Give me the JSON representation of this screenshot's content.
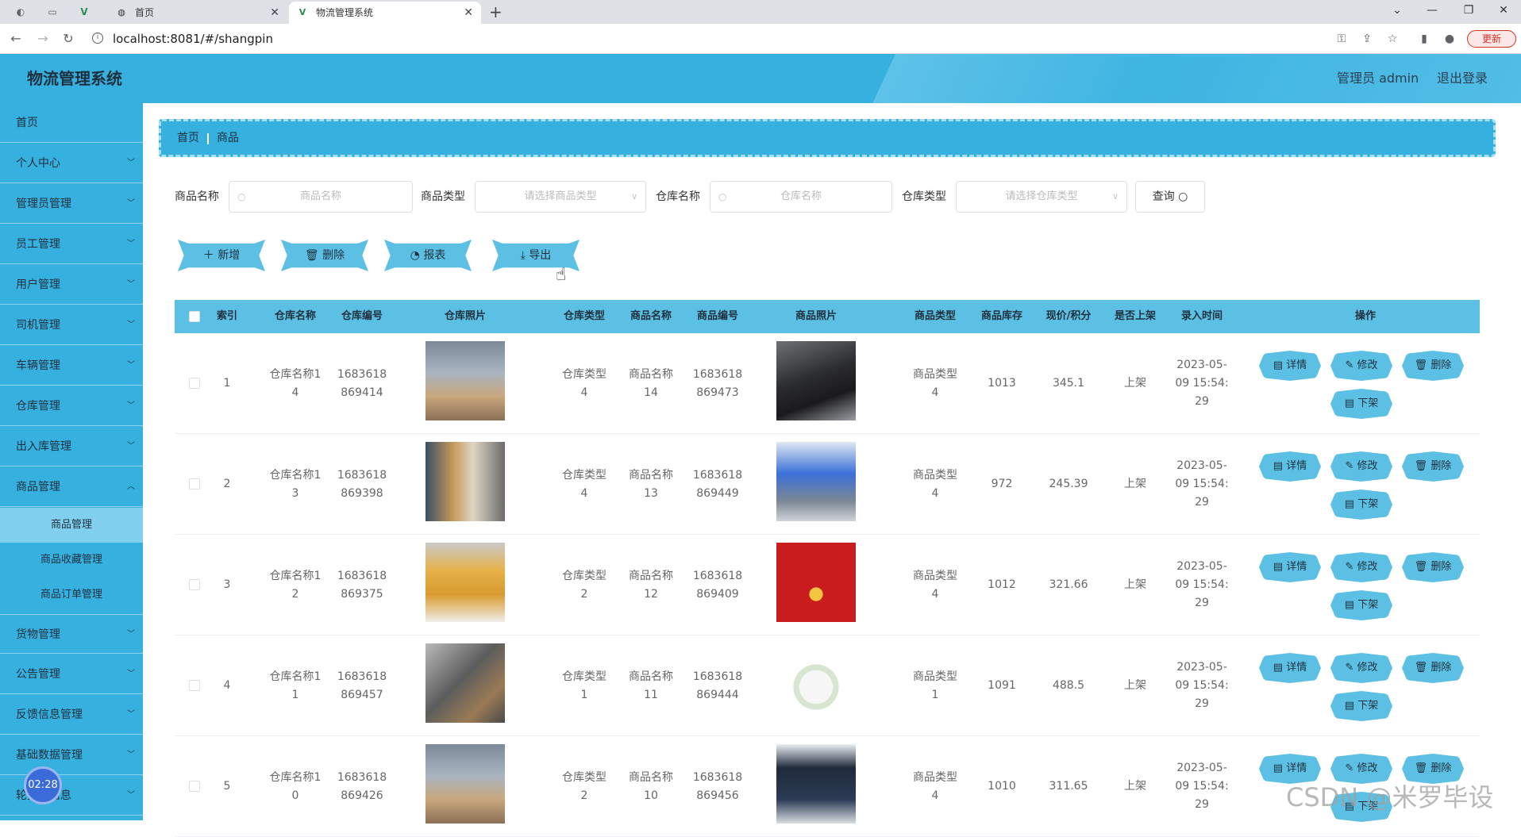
{
  "browser": {
    "tabs": [
      {
        "label": "首页",
        "active": false
      },
      {
        "label": "物流管理系统",
        "active": true
      }
    ],
    "new_tab": "+",
    "url": "localhost:8081/#/shangpin",
    "update_label": "更新"
  },
  "header": {
    "title": "物流管理系统",
    "user_label": "管理员 admin",
    "logout_label": "退出登录"
  },
  "sidebar": {
    "items": [
      {
        "label": "首页"
      },
      {
        "label": "个人中心"
      },
      {
        "label": "管理员管理"
      },
      {
        "label": "员工管理"
      },
      {
        "label": "用户管理"
      },
      {
        "label": "司机管理"
      },
      {
        "label": "车辆管理"
      },
      {
        "label": "仓库管理"
      },
      {
        "label": "出入库管理"
      },
      {
        "label": "商品管理"
      }
    ],
    "sub_items": [
      {
        "label": "商品管理",
        "active": true
      },
      {
        "label": "商品收藏管理",
        "active": false
      },
      {
        "label": "商品订单管理",
        "active": false
      }
    ],
    "more_items": [
      {
        "label": "货物管理"
      },
      {
        "label": "公告管理"
      },
      {
        "label": "反馈信息管理"
      },
      {
        "label": "基础数据管理"
      },
      {
        "label": "轮播图信息"
      }
    ],
    "clock": "02:28"
  },
  "breadcrumb": [
    "首页",
    "商品"
  ],
  "filters": {
    "name_label": "商品名称",
    "name_placeholder": "商品名称",
    "type_label": "商品类型",
    "type_placeholder": "请选择商品类型",
    "warehouse_label": "仓库名称",
    "warehouse_placeholder": "仓库名称",
    "warehouse_type_label": "仓库类型",
    "warehouse_type_placeholder": "请选择仓库类型",
    "query_label": "查询"
  },
  "actions": {
    "add": "新增",
    "delete": "删除",
    "report": "报表",
    "export": "导出"
  },
  "table": {
    "headers": [
      "索引",
      "仓库名称",
      "仓库编号",
      "仓库照片",
      "仓库类型",
      "商品名称",
      "商品编号",
      "商品照片",
      "商品类型",
      "商品库存",
      "现价/积分",
      "是否上架",
      "录入时间",
      "操作"
    ],
    "row_buttons": {
      "detail": "详情",
      "edit": "修改",
      "delete": "删除",
      "off": "下架"
    },
    "rows": [
      {
        "index": "1",
        "warehouse_name": [
          "仓库名称1",
          "4"
        ],
        "warehouse_no": [
          "1683618",
          "869414"
        ],
        "warehouse_type": [
          "仓库类型",
          "4"
        ],
        "product_name": [
          "商品名称",
          "14"
        ],
        "product_no": [
          "1683618",
          "869473"
        ],
        "product_type": [
          "商品类型",
          "4"
        ],
        "stock": "1013",
        "price": "345.1",
        "on_shelf": "上架",
        "time": [
          "2023-05-",
          "09 15:54:",
          "29"
        ]
      },
      {
        "index": "2",
        "warehouse_name": [
          "仓库名称1",
          "3"
        ],
        "warehouse_no": [
          "1683618",
          "869398"
        ],
        "warehouse_type": [
          "仓库类型",
          "4"
        ],
        "product_name": [
          "商品名称",
          "13"
        ],
        "product_no": [
          "1683618",
          "869449"
        ],
        "product_type": [
          "商品类型",
          "4"
        ],
        "stock": "972",
        "price": "245.39",
        "on_shelf": "上架",
        "time": [
          "2023-05-",
          "09 15:54:",
          "29"
        ]
      },
      {
        "index": "3",
        "warehouse_name": [
          "仓库名称1",
          "2"
        ],
        "warehouse_no": [
          "1683618",
          "869375"
        ],
        "warehouse_type": [
          "仓库类型",
          "2"
        ],
        "product_name": [
          "商品名称",
          "12"
        ],
        "product_no": [
          "1683618",
          "869409"
        ],
        "product_type": [
          "商品类型",
          "4"
        ],
        "stock": "1012",
        "price": "321.66",
        "on_shelf": "上架",
        "time": [
          "2023-05-",
          "09 15:54:",
          "29"
        ]
      },
      {
        "index": "4",
        "warehouse_name": [
          "仓库名称1",
          "1"
        ],
        "warehouse_no": [
          "1683618",
          "869457"
        ],
        "warehouse_type": [
          "仓库类型",
          "1"
        ],
        "product_name": [
          "商品名称",
          "11"
        ],
        "product_no": [
          "1683618",
          "869444"
        ],
        "product_type": [
          "商品类型",
          "1"
        ],
        "stock": "1091",
        "price": "488.5",
        "on_shelf": "上架",
        "time": [
          "2023-05-",
          "09 15:54:",
          "29"
        ]
      },
      {
        "index": "5",
        "warehouse_name": [
          "仓库名称1",
          "0"
        ],
        "warehouse_no": [
          "1683618",
          "869426"
        ],
        "warehouse_type": [
          "仓库类型",
          "2"
        ],
        "product_name": [
          "商品名称",
          "10"
        ],
        "product_no": [
          "1683618",
          "869456"
        ],
        "product_type": [
          "商品类型",
          "4"
        ],
        "stock": "1010",
        "price": "311.65",
        "on_shelf": "上架",
        "time": [
          "2023-05-",
          "09 15:54:",
          "29"
        ]
      }
    ]
  },
  "watermark": "CSDN @米罗毕设"
}
